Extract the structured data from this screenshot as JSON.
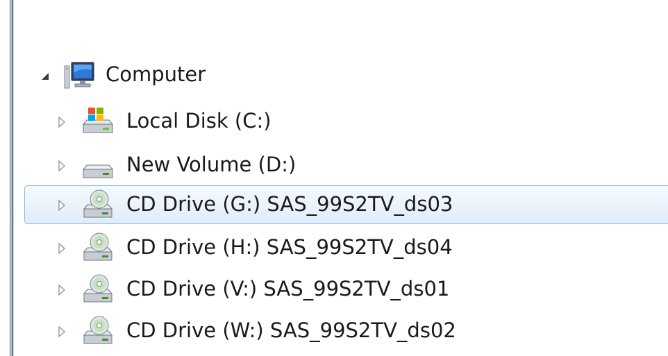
{
  "tree": {
    "root": {
      "label": "Computer",
      "icon": "computer-icon",
      "expanded": true
    },
    "items": [
      {
        "label": "Local Disk (C:)",
        "icon": "system-drive-icon",
        "selected": false
      },
      {
        "label": "New Volume (D:)",
        "icon": "hard-drive-icon",
        "selected": false
      },
      {
        "label": "CD Drive (G:) SAS_99S2TV_ds03",
        "icon": "cd-drive-icon",
        "selected": true
      },
      {
        "label": "CD Drive (H:) SAS_99S2TV_ds04",
        "icon": "cd-drive-icon",
        "selected": false
      },
      {
        "label": "CD Drive (V:) SAS_99S2TV_ds01",
        "icon": "cd-drive-icon",
        "selected": false
      },
      {
        "label": "CD Drive (W:) SAS_99S2TV_ds02",
        "icon": "cd-drive-icon",
        "selected": false
      }
    ]
  },
  "colors": {
    "selection_border": "#86b8e8",
    "selection_fill": "#e8f1fb",
    "text": "#1a1a1a",
    "expander": "#7a7a7a"
  }
}
